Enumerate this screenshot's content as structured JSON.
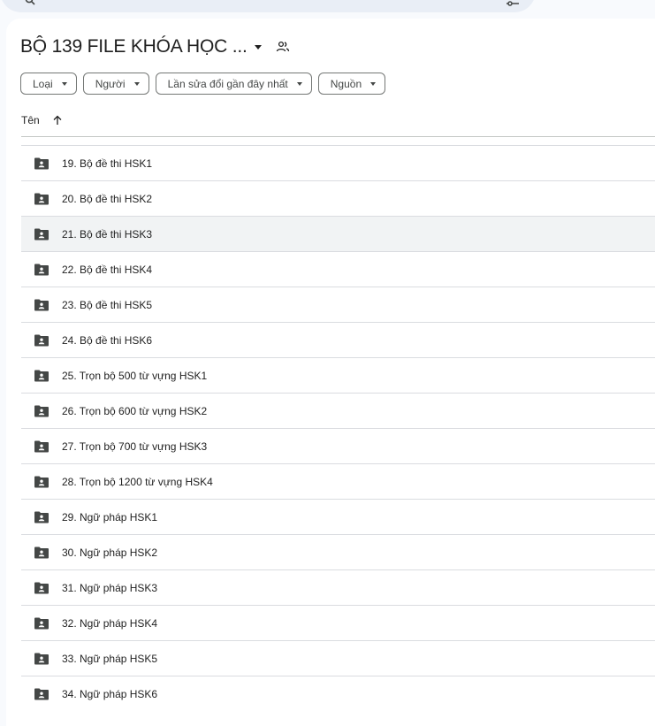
{
  "colors": {
    "page_bg": "#f8fafd",
    "panel_bg": "#ffffff",
    "searchbar_bg": "#e9eef6",
    "text": "#1f1f1f",
    "folder_icon": "#444746",
    "row_highlight": "#f1f3f4"
  },
  "search": {
    "search_icon": "search-icon",
    "tune_icon": "tune-icon"
  },
  "folder": {
    "title": "BỘ 139 FILE KHÓA HỌC ...",
    "shared_icon": "shared-folder-icon"
  },
  "filters": [
    {
      "label": "Loại"
    },
    {
      "label": "Người"
    },
    {
      "label": "Lần sửa đổi gần đây nhất"
    },
    {
      "label": "Nguồn"
    }
  ],
  "columns": {
    "name": "Tên",
    "sort_icon": "arrow-up-icon"
  },
  "items": [
    {
      "name": "19. Bộ đề thi HSK1",
      "icon": "shared-folder-icon",
      "highlighted": false
    },
    {
      "name": "20. Bộ đề thi HSK2",
      "icon": "shared-folder-icon",
      "highlighted": false
    },
    {
      "name": "21. Bộ đề thi HSK3",
      "icon": "shared-folder-icon",
      "highlighted": true
    },
    {
      "name": "22. Bộ đề thi HSK4",
      "icon": "shared-folder-icon",
      "highlighted": false
    },
    {
      "name": "23. Bộ đề thi HSK5",
      "icon": "shared-folder-icon",
      "highlighted": false
    },
    {
      "name": "24. Bộ đề thi HSK6",
      "icon": "shared-folder-icon",
      "highlighted": false
    },
    {
      "name": "25. Trọn bộ 500 từ vựng HSK1",
      "icon": "shared-folder-icon",
      "highlighted": false
    },
    {
      "name": "26. Trọn bộ 600 từ vựng HSK2",
      "icon": "shared-folder-icon",
      "highlighted": false
    },
    {
      "name": "27. Trọn bộ 700 từ vựng HSK3",
      "icon": "shared-folder-icon",
      "highlighted": false
    },
    {
      "name": "28. Trọn bộ 1200 từ vựng HSK4",
      "icon": "shared-folder-icon",
      "highlighted": false
    },
    {
      "name": "29. Ngữ pháp HSK1",
      "icon": "shared-folder-icon",
      "highlighted": false
    },
    {
      "name": "30. Ngữ pháp HSK2",
      "icon": "shared-folder-icon",
      "highlighted": false
    },
    {
      "name": "31. Ngữ pháp HSK3",
      "icon": "shared-folder-icon",
      "highlighted": false
    },
    {
      "name": "32. Ngữ pháp HSK4",
      "icon": "shared-folder-icon",
      "highlighted": false
    },
    {
      "name": "33. Ngữ pháp HSK5",
      "icon": "shared-folder-icon",
      "highlighted": false
    },
    {
      "name": "34. Ngữ pháp HSK6",
      "icon": "shared-folder-icon",
      "highlighted": false
    }
  ]
}
